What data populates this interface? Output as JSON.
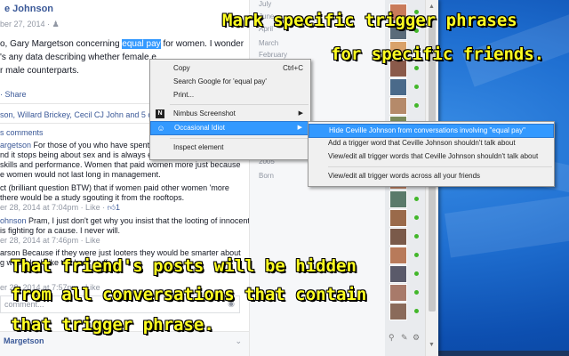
{
  "feed": {
    "author": "e Johnson",
    "timestamp": "ber 27, 2014 ·",
    "post_prefix": "o, Gary Margetson concerning ",
    "post_highlight": "equal pay",
    "post_suffix": " for women. I wonder",
    "post_line2": "'s any data describing whether female e",
    "post_line3": "r male counterparts.",
    "share_label": "· Share",
    "likers": "son, Willard Brickey, Cecil CJ John and 5 other",
    "comments_label": "s comments",
    "comment1_author": "argetson",
    "comment1_l1": " For those of you who have spent time",
    "comment1_l2": "nd it stops being about sex and is always empl",
    "comment1_l3": "skills and performance. Women that paid women more just because",
    "comment1_l4": "e women would not last long in management.",
    "comment2_l1": "ct (brilliant question BTW) that if women paid other women 'more",
    "comment2_l2": "there would be a study sgouting it from the rooftops.",
    "comment2_meta": "er 28, 2014 at 7:04pm · Like · ",
    "comment2_likes": "1",
    "comment3_author": "ohnson",
    "comment3_l1": " Pram, I just don't get why you insist that the looting of innocent",
    "comment3_l2": "is fighting for a cause. I never will.",
    "comment3_meta": "er 28, 2014 at 7:46pm · Like",
    "comment4_l1": "arson  Because if they were just looters they would be smarter about",
    "comment4_l2": "g would look like the hard stuff",
    "comment4_meta": "er 28, 2014 at 7:57pm · Like",
    "comment_box": "comment...",
    "bottom_author": "Margetson"
  },
  "timeline": {
    "items": [
      "July",
      "June",
      "April",
      "March",
      "February",
      "",
      "",
      "",
      "",
      "",
      "",
      "",
      "2005",
      "Born"
    ]
  },
  "context_menu": {
    "items": [
      {
        "label": "Copy",
        "shortcut": "Ctrl+C"
      },
      {
        "label": "Search Google for 'equal pay'"
      },
      {
        "label": "Print..."
      },
      {
        "label": "Nimbus Screenshot",
        "icon": "N"
      },
      {
        "label": "Occasional Idiot",
        "icon": "☺"
      },
      {
        "label": "Inspect element"
      }
    ]
  },
  "submenu": {
    "items": [
      "Hide Ceville Johnson from conversations involving \"equal pay\"",
      "Add a trigger word that Ceville Johnson shouldn't talk about",
      "View/edit all trigger words that Ceville Johnson shouldn't talk about",
      "View/edit all trigger words across all your friends"
    ]
  },
  "captions": {
    "top_line1": "Mark specific trigger phrases",
    "top_line2": "for specific friends.",
    "bottom_line1": "That friend's posts will be hidden",
    "bottom_line2": "from all conversations that contain",
    "bottom_line3": "that trigger phrase."
  },
  "colors": {
    "desktop": "#1f6fd1",
    "highlight": "#3399ff",
    "caption": "#ffff22",
    "facebook_link": "#3b5998"
  }
}
